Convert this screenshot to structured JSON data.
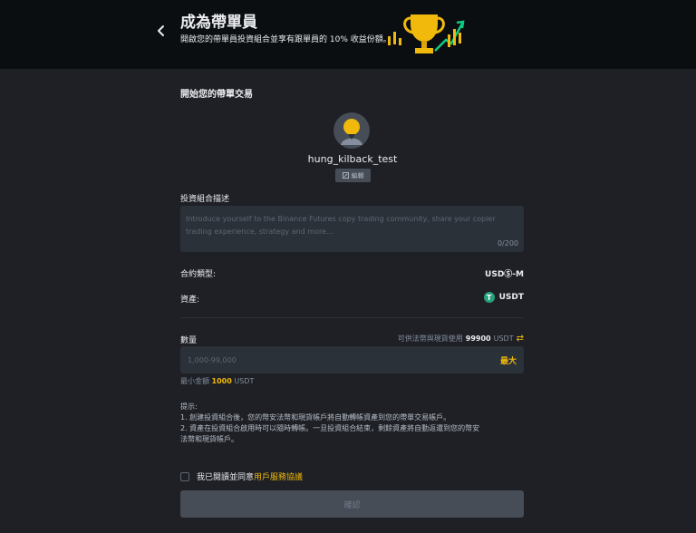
{
  "header": {
    "title": "成為帶單員",
    "subtitle": "開啟您的帶單員投資組合並享有跟單員的 10% 收益份額。"
  },
  "colors": {
    "accent": "#f0b90b",
    "background": "#1e2026",
    "header_bg": "#0b0e11",
    "input_bg": "#2b3139",
    "tether": "#26a17b"
  },
  "section": {
    "title": "開始您的帶單交易"
  },
  "profile": {
    "username": "hung_kilback_test",
    "edit_label": "編輯"
  },
  "description": {
    "label": "投資組合描述",
    "placeholder": "Introduce yourself to the Binance Futures copy trading community, share your copier trading experience, strategy and more...",
    "counter": "0/200"
  },
  "contract": {
    "label": "合約類型:",
    "value": "USDⓈ-M"
  },
  "asset": {
    "label": "資產:",
    "value": "USDT",
    "icon": "tether-icon"
  },
  "quantity": {
    "label": "數量",
    "available_prefix": "可供法幣與現貨使用",
    "available_amount": "99900",
    "available_unit": "USDT",
    "placeholder": "1,000-99,000",
    "max_label": "最大",
    "min_prefix": "最小金額",
    "min_amount": "1000",
    "min_unit": "USDT"
  },
  "tips": {
    "title": "提示:",
    "line1": "1. 創建投資組合後，您的幣安法幣和現貨帳戶將自動轉帳資產到您的帶單交易帳戶。",
    "line2": "2. 資產在投資組合啟用時可以隨時轉帳。一旦投資組合結束，剩餘資產將自動返還到您的幣安",
    "line3": "法幣和現貨帳戶。"
  },
  "agreement": {
    "prefix": "我已閱讀並同意",
    "link": "用戶服務協議"
  },
  "confirm_label": "確認"
}
